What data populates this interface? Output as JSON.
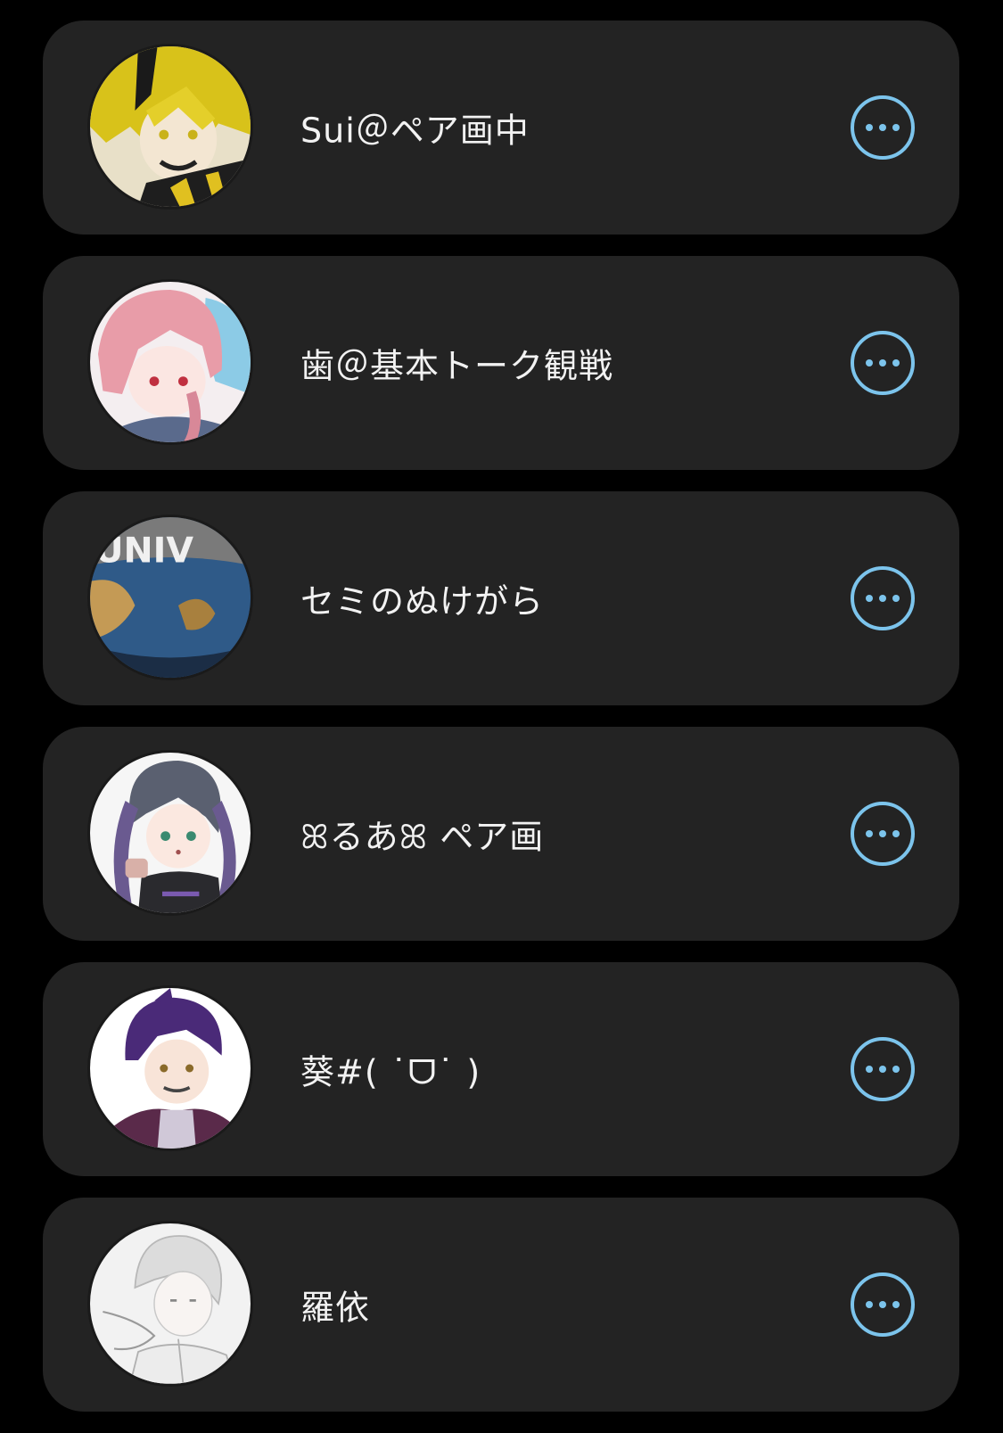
{
  "colors": {
    "background": "#000000",
    "card": "#232323",
    "text": "#f2f2f2",
    "accent": "#7cc4ec"
  },
  "users": [
    {
      "name": "Sui＠ペア画中",
      "avatar": "avatar-yellow-hair-character",
      "more_icon": "more-horizontal-icon"
    },
    {
      "name": "歯＠基本トーク観戦",
      "avatar": "avatar-pink-hair-character",
      "more_icon": "more-horizontal-icon"
    },
    {
      "name": "セミのぬけがら",
      "avatar": "avatar-globe-universal",
      "more_icon": "more-horizontal-icon"
    },
    {
      "name": "ꕤるあꕤ ペア画",
      "avatar": "avatar-twin-tail-character",
      "more_icon": "more-horizontal-icon"
    },
    {
      "name": "葵#( ˙ᗜ˙ )",
      "avatar": "avatar-purple-hair-character",
      "more_icon": "more-horizontal-icon"
    },
    {
      "name": "羅依",
      "avatar": "avatar-white-hair-sketch",
      "more_icon": "more-horizontal-icon"
    }
  ]
}
